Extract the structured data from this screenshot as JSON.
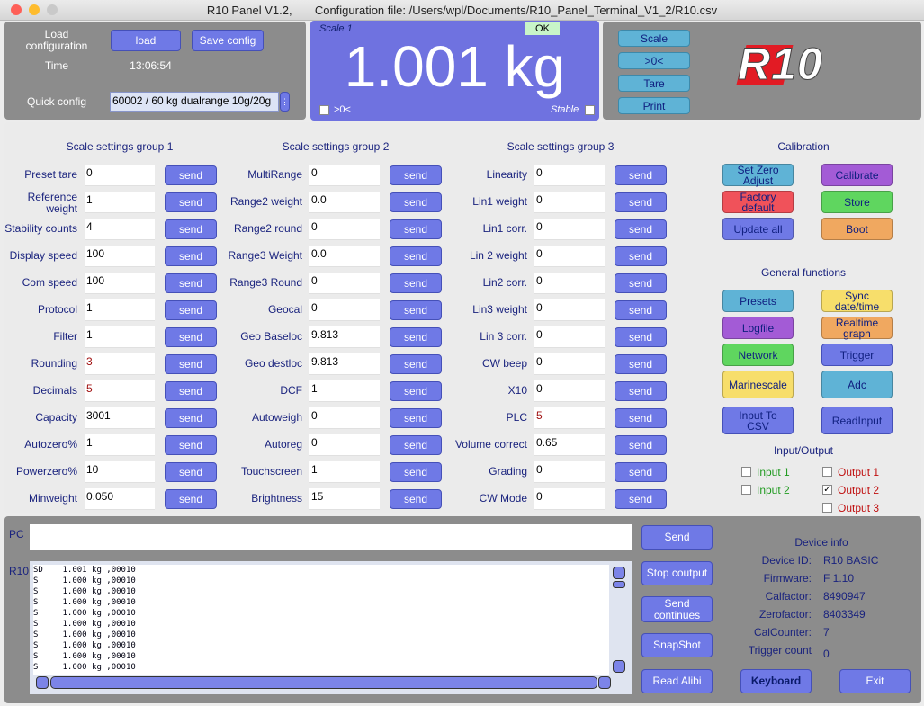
{
  "window": {
    "title": "R10 Panel V1.2,       Configuration file: /Users/wpl/Documents/R10_Panel_Terminal_V1_2/R10.csv",
    "traffic_colors": [
      "#fe5f57",
      "#febc2e",
      "#28c840"
    ]
  },
  "top": {
    "load_config_label": "Load\nconfiguration",
    "load_button": "load",
    "save_button": "Save config",
    "time_label": "Time",
    "time_value": "13:06:54",
    "quick_config_label": "Quick config",
    "quick_config_value": "60002  / 60 kg dualrange 10g/20g"
  },
  "display": {
    "scale_name": "Scale 1",
    "ok_badge": "OK",
    "weight": "1.001 kg",
    "zero_label": ">0<",
    "stable_label": "Stable"
  },
  "scale_buttons": [
    "Scale",
    ">0<",
    "Tare",
    "Print"
  ],
  "logo_text": "R10",
  "groups": [
    {
      "title": "Scale settings group 1",
      "rows": [
        {
          "label": "Preset tare",
          "value": "0",
          "send": "send"
        },
        {
          "label": "Reference\nweight",
          "value": "1",
          "send": "send"
        },
        {
          "label": "Stability counts",
          "value": "4",
          "send": "send"
        },
        {
          "label": "Display speed",
          "value": "100",
          "send": "send"
        },
        {
          "label": "Com speed",
          "value": "100",
          "send": "send"
        },
        {
          "label": "Protocol",
          "value": "1",
          "send": "send"
        },
        {
          "label": "Filter",
          "value": "1",
          "send": "send"
        },
        {
          "label": "Rounding",
          "value": "3",
          "send": "send",
          "red": true
        },
        {
          "label": "Decimals",
          "value": "5",
          "send": "send",
          "red": true
        },
        {
          "label": "Capacity",
          "value": "3001",
          "send": "send"
        },
        {
          "label": "Autozero%",
          "value": "1",
          "send": "send"
        },
        {
          "label": "Powerzero%",
          "value": "10",
          "send": "send"
        },
        {
          "label": "Minweight",
          "value": "0.050",
          "send": "send"
        }
      ]
    },
    {
      "title": "Scale settings group 2",
      "rows": [
        {
          "label": "MultiRange",
          "value": "0",
          "send": "send"
        },
        {
          "label": "Range2 weight",
          "value": "0.0",
          "send": "send"
        },
        {
          "label": "Range2 round",
          "value": "0",
          "send": "send"
        },
        {
          "label": "Range3 Weight",
          "value": "0.0",
          "send": "send"
        },
        {
          "label": "Range3 Round",
          "value": "0",
          "send": "send"
        },
        {
          "label": "Geocal",
          "value": "0",
          "send": "send"
        },
        {
          "label": "Geo Baseloc",
          "value": "9.813",
          "send": "send"
        },
        {
          "label": "Geo destloc",
          "value": "9.813",
          "send": "send"
        },
        {
          "label": "DCF",
          "value": "1",
          "send": "send"
        },
        {
          "label": "Autoweigh",
          "value": "0",
          "send": "send"
        },
        {
          "label": "Autoreg",
          "value": "0",
          "send": "send"
        },
        {
          "label": "Touchscreen",
          "value": "1",
          "send": "send"
        },
        {
          "label": "Brightness",
          "value": "15",
          "send": "send"
        }
      ]
    },
    {
      "title": "Scale settings group 3",
      "rows": [
        {
          "label": "Linearity",
          "value": "0",
          "send": "send"
        },
        {
          "label": "Lin1 weight",
          "value": "0",
          "send": "send"
        },
        {
          "label": "Lin1 corr.",
          "value": "0",
          "send": "send"
        },
        {
          "label": "Lin 2 weight",
          "value": "0",
          "send": "send"
        },
        {
          "label": "Lin2 corr.",
          "value": "0",
          "send": "send"
        },
        {
          "label": "Lin3 weight",
          "value": "0",
          "send": "send"
        },
        {
          "label": "Lin 3 corr.",
          "value": "0",
          "send": "send"
        },
        {
          "label": "CW beep",
          "value": "0",
          "send": "send"
        },
        {
          "label": "X10",
          "value": "0",
          "send": "send"
        },
        {
          "label": "PLC",
          "value": "5",
          "send": "send",
          "red": true
        },
        {
          "label": "Volume correct",
          "value": "0.65",
          "send": "send"
        },
        {
          "label": "Grading",
          "value": "0",
          "send": "send"
        },
        {
          "label": "CW Mode",
          "value": "0",
          "send": "send"
        }
      ]
    }
  ],
  "calibration": {
    "title": "Calibration",
    "buttons": [
      {
        "label": "Set Zero\nAdjust",
        "color": "#5fb3d6"
      },
      {
        "label": "Calibrate",
        "color": "#a35bd6"
      },
      {
        "label": "Factory\ndefault",
        "color": "#f0525a"
      },
      {
        "label": "Store",
        "color": "#5fd65f"
      },
      {
        "label": "Update all",
        "color": "#6f79e6"
      },
      {
        "label": "Boot",
        "color": "#f0a860"
      }
    ]
  },
  "general": {
    "title": "General functions",
    "buttons": [
      {
        "label": "Presets",
        "color": "#5fb3d6"
      },
      {
        "label": "Sync\ndate/time",
        "color": "#f7de6b"
      },
      {
        "label": "Logfile",
        "color": "#a35bd6"
      },
      {
        "label": "Realtime\ngraph",
        "color": "#f0a860"
      },
      {
        "label": "Network",
        "color": "#5fd65f"
      },
      {
        "label": "Trigger",
        "color": "#6f79e6"
      },
      {
        "label": "Marinescale",
        "color": "#f7de6b"
      },
      {
        "label": "Adc",
        "color": "#5fb3d6"
      },
      {
        "label": "Input To\nCSV",
        "color": "#6f79e6"
      },
      {
        "label": "ReadInput",
        "color": "#6f79e6"
      }
    ]
  },
  "io": {
    "title": "Input/Output",
    "inputs": [
      {
        "label": "Input 1",
        "checked": false
      },
      {
        "label": "Input 2",
        "checked": false
      }
    ],
    "outputs": [
      {
        "label": "Output 1",
        "checked": false
      },
      {
        "label": "Output 2",
        "checked": true
      },
      {
        "label": "Output 3",
        "checked": false
      }
    ]
  },
  "terminal": {
    "pc_label": "PC",
    "r10_label": "R10",
    "pc_value": "",
    "console_lines": [
      "SD    1.001 kg ,00010",
      "S     1.000 kg ,00010",
      "S     1.000 kg ,00010",
      "S     1.000 kg ,00010",
      "S     1.000 kg ,00010",
      "S     1.000 kg ,00010",
      "S     1.000 kg ,00010",
      "S     1.000 kg ,00010",
      "S     1.000 kg ,00010",
      "S     1.000 kg ,00010"
    ],
    "buttons": [
      "Send",
      "Stop coutput",
      "Send\ncontinues",
      "SnapShot",
      "Read Alibi"
    ],
    "keyboard": "Keyboard",
    "exit": "Exit"
  },
  "device_info": {
    "title": "Device info",
    "rows": [
      {
        "label": "Device ID:",
        "value": "R10 BASIC"
      },
      {
        "label": "Firmware:",
        "value": "F 1.10"
      },
      {
        "label": "Calfactor:",
        "value": "8490947"
      },
      {
        "label": "Zerofactor:",
        "value": "8403349"
      },
      {
        "label": "CalCounter:",
        "value": "7"
      },
      {
        "label": "Trigger count",
        "value": "0"
      }
    ]
  }
}
